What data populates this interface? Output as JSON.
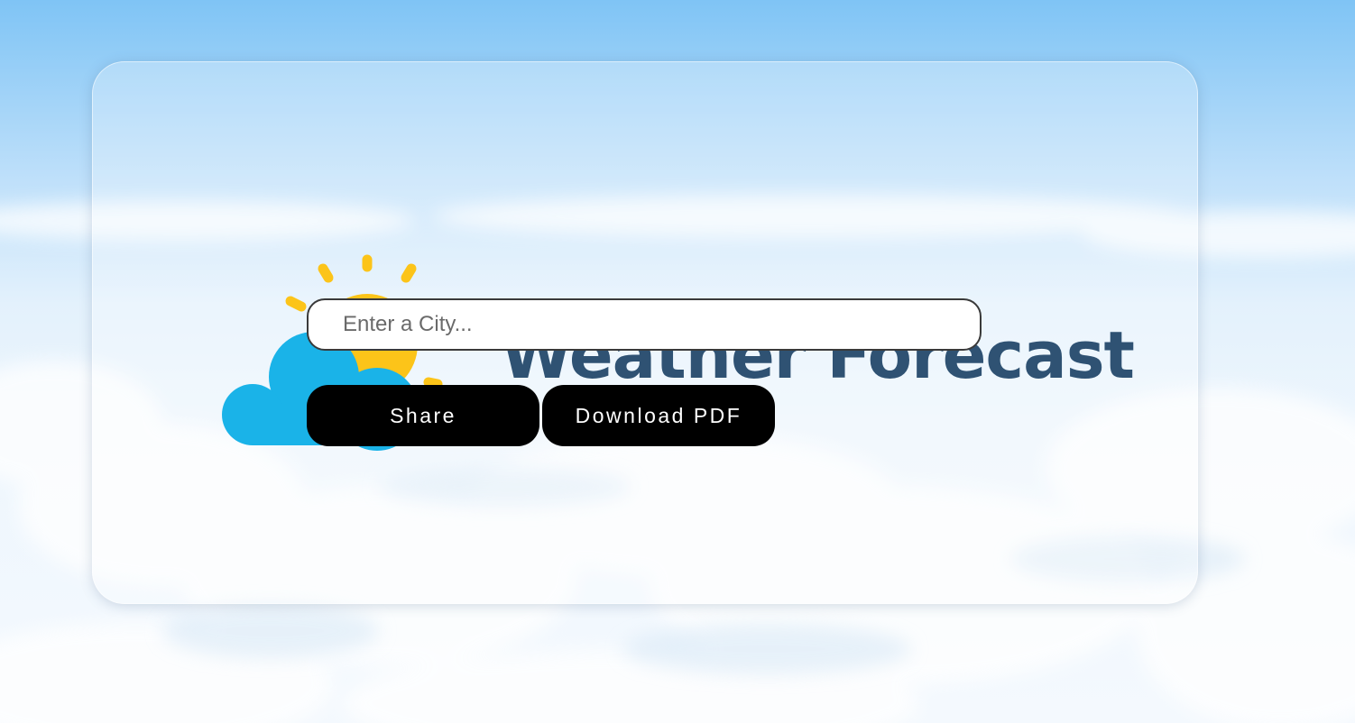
{
  "header": {
    "title": "Weather Forecast",
    "logo_icon": "sun-cloud-icon"
  },
  "search": {
    "placeholder": "Enter a City...",
    "value": ""
  },
  "actions": {
    "share_label": "Share",
    "download_label": "Download PDF"
  },
  "colors": {
    "title": "#2f5273",
    "button_bg": "#000000",
    "button_text": "#ffffff",
    "sun": "#fcc419",
    "cloud": "#1ab3e8",
    "sky_top": "#7fc4f5"
  }
}
